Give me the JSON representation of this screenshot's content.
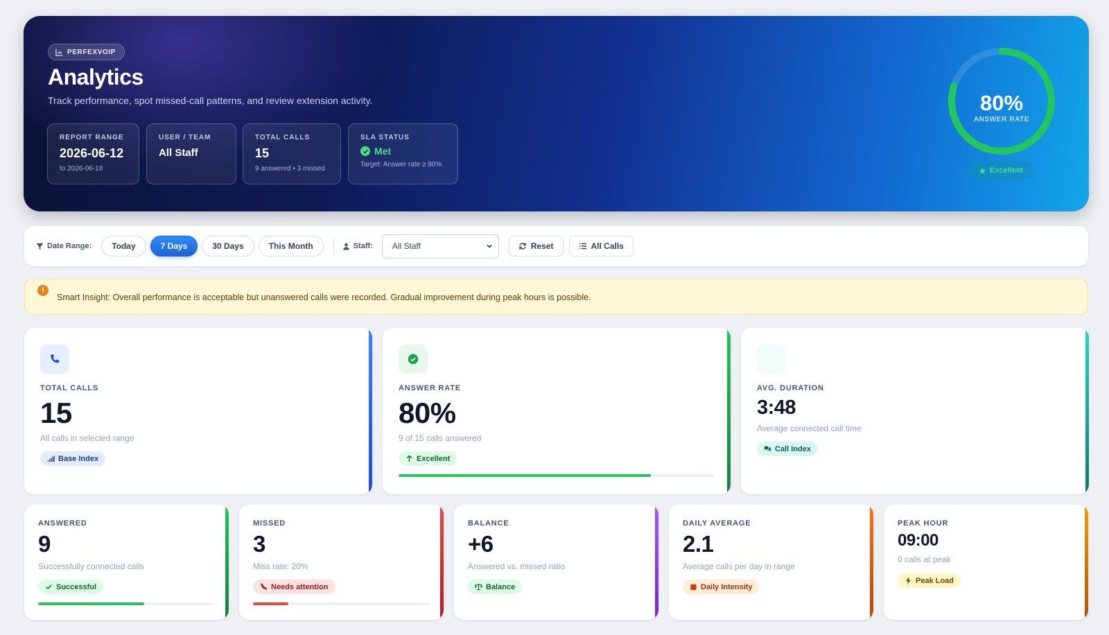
{
  "hero": {
    "brand": "PERFEXVOIP",
    "title": "Analytics",
    "subtitle": "Track performance, spot missed-call patterns, and review extension activity.",
    "stats": {
      "report_range": {
        "label": "REPORT RANGE",
        "value": "2026-06-12",
        "note": "to 2026-06-18"
      },
      "user_team": {
        "label": "USER / TEAM",
        "value": "All Staff"
      },
      "total_calls": {
        "label": "TOTAL CALLS",
        "value": "15",
        "note": "9 answered • 3 missed"
      },
      "sla_status": {
        "label": "SLA STATUS",
        "value": "Met",
        "note": "Target: Answer rate ≥ 80%"
      }
    },
    "ring": {
      "value": "80%",
      "label": "ANSWER RATE",
      "fraction": 0.8,
      "badge": "Excellent"
    }
  },
  "filters": {
    "date_range_label": "Date Range:",
    "ranges": [
      "Today",
      "7 Days",
      "30 Days",
      "This Month"
    ],
    "active_range": "7 Days",
    "staff_label": "Staff:",
    "staff_selected": "All Staff",
    "reset_label": "Reset",
    "all_calls_label": "All Calls"
  },
  "insight": {
    "text": "Smart Insight: Overall performance is acceptable but unanswered calls were recorded. Gradual improvement during peak hours is possible."
  },
  "kpis": {
    "total_calls": {
      "label": "TOTAL CALLS",
      "value": "15",
      "note": "All calls in selected range",
      "badge": "Base Index"
    },
    "answer_rate": {
      "label": "ANSWER RATE",
      "value": "80%",
      "note": "9 of 15 calls answered",
      "badge": "Excellent",
      "progress": 0.8
    },
    "avg_duration": {
      "label": "AVG. DURATION",
      "value": "3:48",
      "note": "Average connected call time",
      "badge": "Call Index"
    },
    "answered": {
      "label": "ANSWERED",
      "value": "9",
      "note": "Successfully connected calls",
      "badge": "Successful",
      "progress": 0.6
    },
    "missed": {
      "label": "MISSED",
      "value": "3",
      "note": "Miss rate: 20%",
      "badge": "Needs attention",
      "progress": 0.2
    },
    "balance": {
      "label": "BALANCE",
      "value": "+6",
      "note": "Answered vs. missed ratio",
      "badge": "Balance"
    },
    "daily_average": {
      "label": "DAILY AVERAGE",
      "value": "2.1",
      "note": "Average calls per day in range",
      "badge": "Daily Intensity"
    },
    "peak_hour": {
      "label": "PEAK HOUR",
      "value": "09:00",
      "note": "0 calls at peak",
      "badge": "Peak Load"
    }
  },
  "colors": {
    "blue": "#2563eb",
    "green": "#16a34a",
    "teal": "#14b8a6",
    "red": "#dc2626",
    "purple": "#9333ea",
    "orange": "#ea580c",
    "amber": "#d97706"
  }
}
